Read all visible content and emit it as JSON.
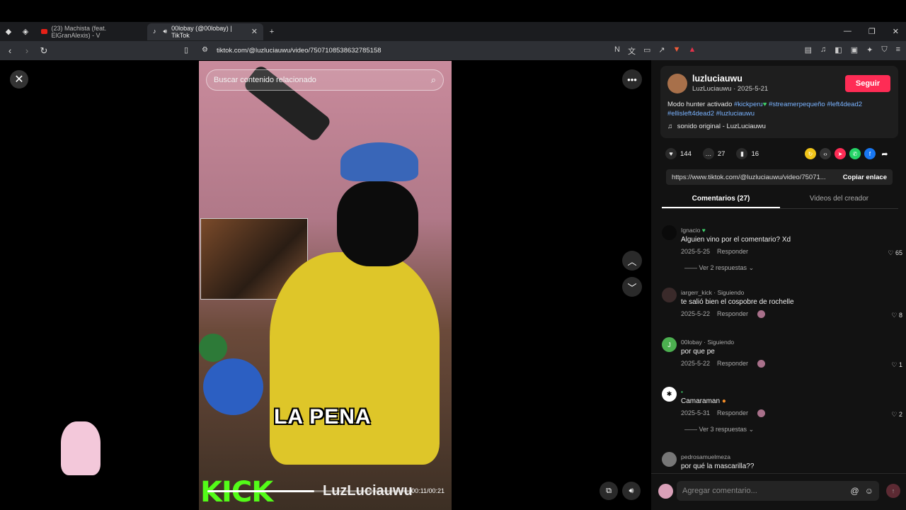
{
  "browser": {
    "tabs": [
      {
        "label": "(23) Machista (feat. ElGranAlexis) - V"
      },
      {
        "label": "00lobay (@00lobay) | TikTok"
      }
    ],
    "url": "tiktok.com/@luzluciauwu/video/7507108538632785158"
  },
  "video": {
    "search_placeholder": "Buscar contenido relacionado",
    "caption": "LA PENA",
    "kick_logo": "KICK",
    "watermark": "LuzLuciauwu",
    "time": "00:11/00:21",
    "progress": 0.52
  },
  "post": {
    "username": "luzluciauwu",
    "meta": "LuzLuciauwu · 2025-5-21",
    "follow_label": "Seguir",
    "desc_text": "Modo hunter activado ",
    "tags": [
      "#kickperu",
      "#streamerpequeño",
      "#left4dead2",
      "#ellisleft4dead2",
      "#luzluciauwu"
    ],
    "sound": "sonido original - LuzLuciauwu",
    "likes": "144",
    "comments_count": "27",
    "saves": "16",
    "link": "https://www.tiktok.com/@luzluciauwu/video/75071...",
    "copy_label": "Copiar enlace"
  },
  "panel_tabs": {
    "comments": "Comentarios (27)",
    "creator_videos": "Videos del creador"
  },
  "comments": [
    {
      "name": "Ignacio",
      "text": "Alguien vino por el comentario? Xd",
      "date": "2025-5-25",
      "reply": "Responder",
      "likes": "65",
      "more": "Ver 2 respuestas"
    },
    {
      "name": "iargerr_kick · Siguiendo",
      "text": "te salió bien el cospobre de rochelle",
      "date": "2025-5-22",
      "reply": "Responder",
      "likes": "8",
      "more": ""
    },
    {
      "name": "00lobay · Siguiendo",
      "text": "por que pe",
      "date": "2025-5-22",
      "reply": "Responder",
      "likes": "1",
      "more": ""
    },
    {
      "name": "",
      "text": "Camaraman",
      "date": "2025-5-31",
      "reply": "Responder",
      "likes": "2",
      "more": "Ver 3 respuestas"
    },
    {
      "name": "pedrosamuelmeza",
      "text": "por qué la mascarilla??",
      "date": "",
      "reply": "",
      "likes": "",
      "more": ""
    }
  ],
  "input": {
    "placeholder": "Agregar comentario..."
  }
}
